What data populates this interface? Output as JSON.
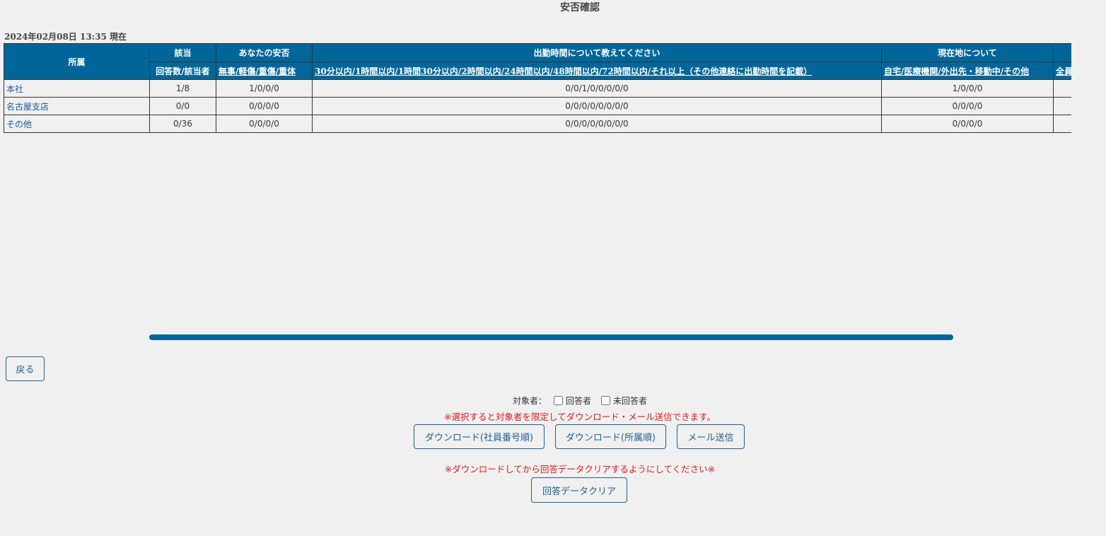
{
  "page": {
    "title": "安否確認"
  },
  "timestamp": "2024年02月08日 13:35 現在",
  "table": {
    "group_headers": {
      "dept": "所属",
      "applicable": "該当",
      "safety": "あなたの安否",
      "commute": "出勤時間について教えてください",
      "location": "現在地について",
      "extra": ""
    },
    "sub_headers": {
      "applicable": "回答数/該当者",
      "safety": "無事/軽傷/重傷/重体",
      "commute": "30分以内/1時間以内/1時間30分以内/2時間以内/24時間以内/48時間以内/72時間以内/それ以上（その他連絡に出勤時間を記載）",
      "location": "自宅/医療機関/外出先・移動中/その他",
      "extra": "全員"
    },
    "rows": [
      {
        "dept": "本社",
        "applicable": "1/8",
        "safety": "1/0/0/0",
        "commute": "0/0/1/0/0/0/0/0",
        "location": "1/0/0/0",
        "extra": ""
      },
      {
        "dept": "名古屋支店",
        "applicable": "0/0",
        "safety": "0/0/0/0",
        "commute": "0/0/0/0/0/0/0/0",
        "location": "0/0/0/0",
        "extra": ""
      },
      {
        "dept": "その他",
        "applicable": "0/36",
        "safety": "0/0/0/0",
        "commute": "0/0/0/0/0/0/0/0",
        "location": "0/0/0/0",
        "extra": ""
      }
    ]
  },
  "buttons": {
    "back": "戻る",
    "download_by_employee": "ダウンロード(社員番号順)",
    "download_by_dept": "ダウンロード(所属順)",
    "send_mail": "メール送信",
    "clear_answers": "回答データクリア"
  },
  "filter": {
    "label": "対象者：",
    "respondents": "回答者",
    "non_respondents": "未回答者",
    "respondents_checked": false,
    "non_respondents_checked": false
  },
  "notes": {
    "filter_note": "※選択すると対象者を限定してダウンロード・メール送信できます。",
    "clear_note": "※ダウンロードしてから回答データクリアするようにしてください※"
  },
  "colors": {
    "header_bg": "#006699",
    "link": "#1a5a9a",
    "warning": "#e0191e",
    "button_border": "#1f5f8f"
  }
}
